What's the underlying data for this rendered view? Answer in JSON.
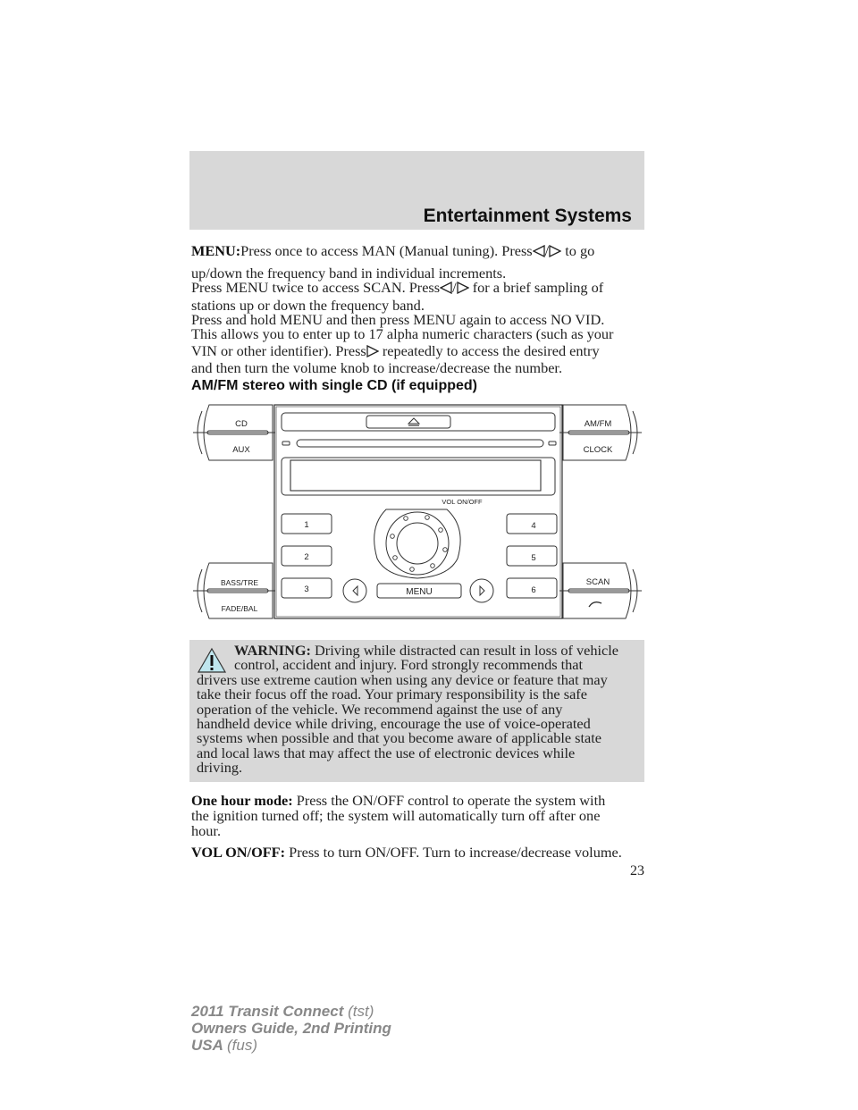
{
  "header": {
    "section_title": "Entertainment Systems"
  },
  "paragraphs": {
    "menu": {
      "label": "MENU:",
      "line1_a": "Press once to access MAN (Manual tuning). Press",
      "line1_b": "to go",
      "line2": "up/down the frequency band in individual increments.",
      "line3_a": "Press MENU twice to access SCAN. Press",
      "line3_b": "for a brief sampling of",
      "line4": "stations up or down the frequency band.",
      "line5": "Press and hold MENU and then press MENU again to access NO VID.",
      "line6": "This allows you to enter up to 17 alpha numeric characters (such as your",
      "line7_a": "VIN or other identifier). Press",
      "line7_b": "repeatedly to access the desired entry",
      "line8": "and then turn the volume knob to increase/decrease the number.",
      "slash": "/"
    },
    "one_hour": {
      "label": "One hour mode:",
      "line1": "Press the ON/OFF control to operate the system with",
      "line2": "the ignition turned off; the system will automatically turn off after one",
      "line3": "hour."
    },
    "vol": {
      "label": "VOL ON/OFF:",
      "text": "Press to turn ON/OFF. Turn to increase/decrease volume."
    }
  },
  "figure": {
    "title": "AM/FM stereo with single CD (if equipped)",
    "buttons": {
      "cd": "CD",
      "aux": "AUX",
      "amfm": "AM/FM",
      "clock": "CLOCK",
      "bass_tre": "BASS/TRE",
      "fade_bal": "FADE/BAL",
      "scan": "SCAN",
      "preset1": "1",
      "preset2": "2",
      "preset3": "3",
      "preset4": "4",
      "preset5": "5",
      "preset6": "6",
      "menu": "MENU",
      "vol_label": "VOL ON/OFF"
    },
    "icons": [
      "eject-icon",
      "seek-left-icon",
      "seek-right-icon",
      "phone-icon"
    ]
  },
  "warning": {
    "label": "WARNING:",
    "lines": [
      "Driving while distracted can result in loss of vehicle",
      "control, accident and injury. Ford strongly recommends that",
      "drivers use extreme caution when using any device or feature that may",
      "take their focus off the road. Your primary responsibility is the safe",
      "operation of the vehicle. We recommend against the use of any",
      "handheld device while driving, encourage the use of voice-operated",
      "systems when possible and that you become aware of applicable state",
      "and local laws that may affect the use of electronic devices while",
      "driving."
    ],
    "icon_color": "#bfe6ee"
  },
  "page_number": "23",
  "footer": {
    "line1_bold": "2011 Transit Connect",
    "line1_light": "(tst)",
    "line2": "Owners Guide, 2nd Printing",
    "line3_bold": "USA",
    "line3_light": "(fus)"
  }
}
